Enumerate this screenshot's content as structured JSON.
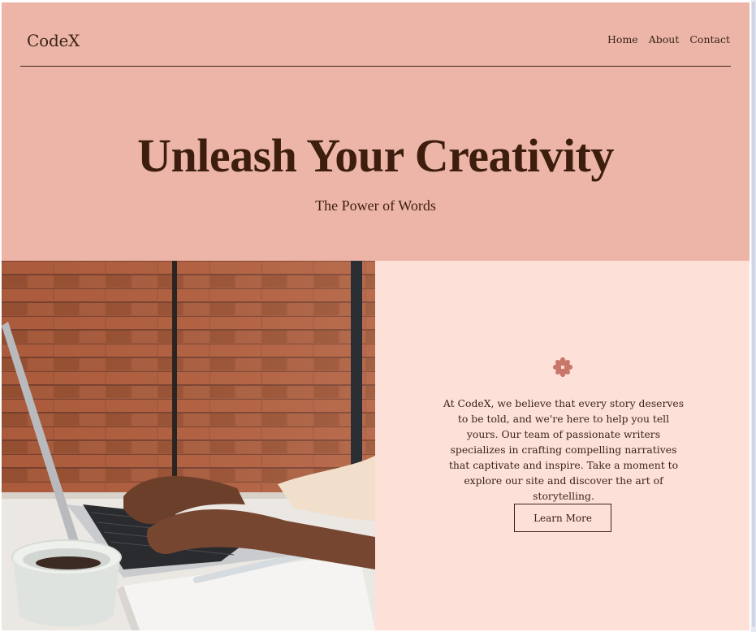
{
  "brand": {
    "name": "CodeX"
  },
  "nav": {
    "items": [
      "Home",
      "About",
      "Contact"
    ]
  },
  "hero": {
    "title": "Unleash Your Creativity",
    "subtitle": "The Power of Words"
  },
  "about": {
    "icon": "asterisk-flower-icon",
    "text": "At CodeX, we believe that every story deserves to be told, and we're here to help you tell yours. Our team of passionate writers specializes in crafting compelling narratives that captivate and inspire. Take a moment to explore our site and discover the art of storytelling.",
    "button_label": "Learn More"
  },
  "image": {
    "description_icon": "laptop-coffee-photo"
  },
  "colors": {
    "header_bg": "#ecb5a8",
    "panel_bg": "#fde1d9",
    "text": "#3a2418",
    "accent": "#c8776a"
  }
}
